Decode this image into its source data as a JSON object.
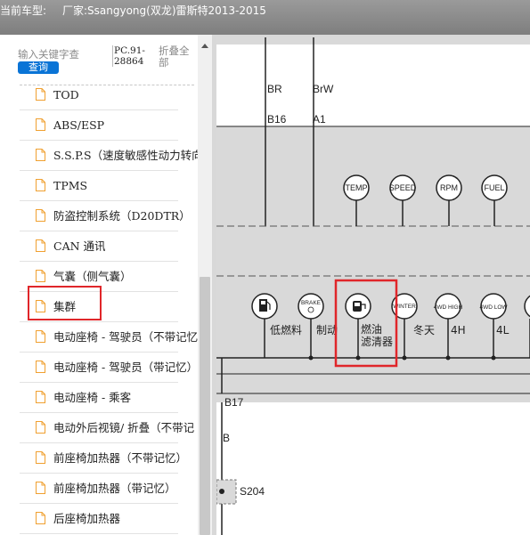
{
  "window": {
    "title_prefix": "当前车型:",
    "title_model": "厂家:Ssangyong(双龙)雷斯特2013-2015"
  },
  "search": {
    "placeholder": "输入关键字查",
    "button_label": "查询",
    "code_label": "PC.91-28864",
    "collapse_label": "折叠全部"
  },
  "tree": {
    "items": [
      {
        "label": "TOD"
      },
      {
        "label": "ABS/ESP"
      },
      {
        "label": "S.S.P.S（速度敏感性动力转向"
      },
      {
        "label": "TPMS"
      },
      {
        "label": "防盗控制系统（D20DTR）"
      },
      {
        "label": "CAN 通讯"
      },
      {
        "label": "气囊（侧气囊）"
      },
      {
        "label": "集群"
      },
      {
        "label": "电动座椅 - 驾驶员（不带记忆"
      },
      {
        "label": "电动座椅 - 驾驶员（带记忆）"
      },
      {
        "label": "电动座椅 - 乘客"
      },
      {
        "label": "电动外后视镜/ 折叠（不带记"
      },
      {
        "label": "前座椅加热器（不带记忆）"
      },
      {
        "label": "前座椅加热器（带记忆）"
      },
      {
        "label": "后座椅加热器"
      }
    ],
    "selected_index": 7
  },
  "diagram": {
    "wire_br": "BR",
    "wire_brw": "BrW",
    "pin_b16": "B16",
    "pin_a1": "A1",
    "gauges": [
      "TEMP",
      "SPEED",
      "RPM",
      "FUEL"
    ],
    "indicators": [
      {
        "glyph": "",
        "label": "低燃料"
      },
      {
        "glyph": "BRAKE",
        "label": "制动"
      },
      {
        "glyph": "",
        "label": "燃油"
      },
      {
        "glyph": "WINTER",
        "label": "冬天"
      },
      {
        "glyph": "4WD HIGH",
        "label": "4H"
      },
      {
        "glyph": "4WD LOW",
        "label": "4L"
      }
    ],
    "fuel_filter_label_line2": "滤清器",
    "pin_b17": "B17",
    "wire_b": "B",
    "splice_s204": "S204"
  },
  "colors": {
    "title_bg": "#8a8a8a",
    "accent_button": "#0a74d6",
    "highlight": "#e0262a",
    "diagram_band": "#d9d9d9",
    "icon_orange": "#f0a030"
  },
  "icons": {
    "tree_item": "document-icon",
    "scroll_up": "triangle-up-icon"
  }
}
